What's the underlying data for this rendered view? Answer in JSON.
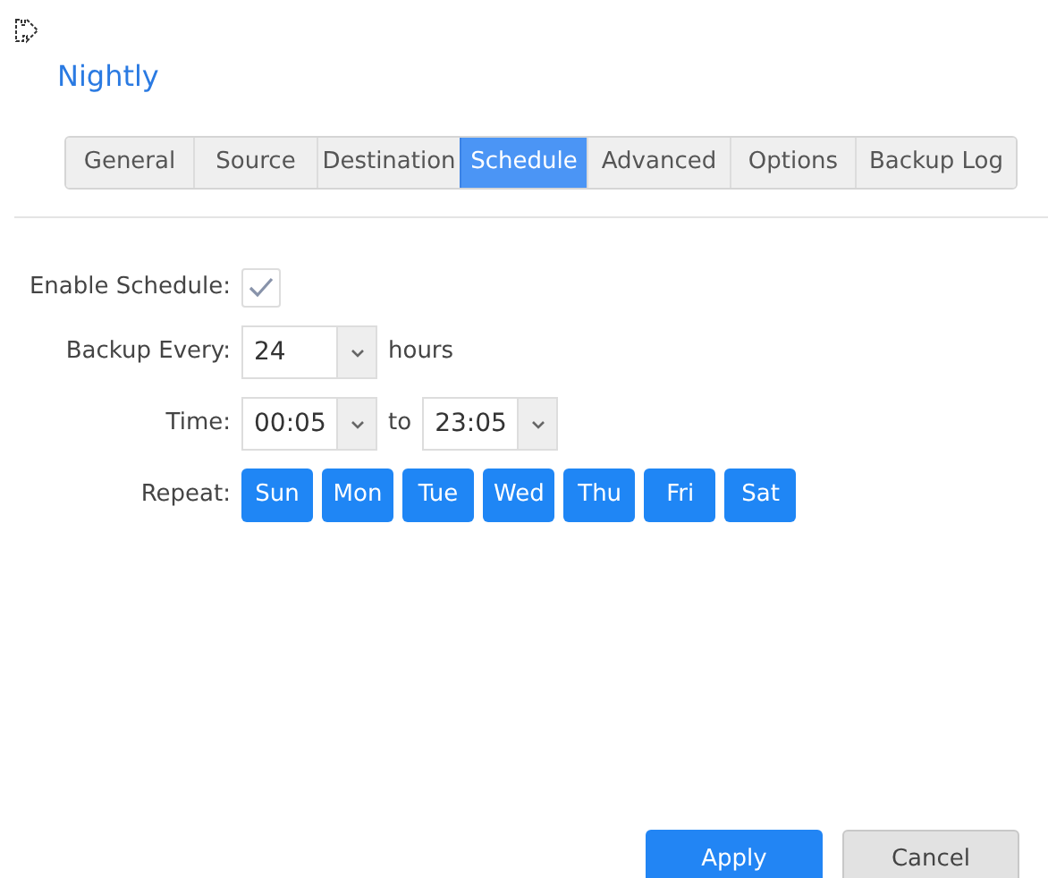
{
  "title": "Nightly",
  "tabs": [
    {
      "label": "General",
      "selected": false
    },
    {
      "label": "Source",
      "selected": false
    },
    {
      "label": "Destination",
      "selected": false
    },
    {
      "label": "Schedule",
      "selected": true
    },
    {
      "label": "Advanced",
      "selected": false
    },
    {
      "label": "Options",
      "selected": false
    },
    {
      "label": "Backup Log",
      "selected": false
    }
  ],
  "enable_schedule": {
    "label": "Enable Schedule:",
    "checked": true
  },
  "backup_every": {
    "label": "Backup Every:",
    "value": "24",
    "unit": "hours"
  },
  "time": {
    "label": "Time:",
    "from": "00:05",
    "separator": "to",
    "to": "23:05"
  },
  "repeat": {
    "label": "Repeat:",
    "days": [
      {
        "label": "Sun",
        "selected": true
      },
      {
        "label": "Mon",
        "selected": true
      },
      {
        "label": "Tue",
        "selected": true
      },
      {
        "label": "Wed",
        "selected": true
      },
      {
        "label": "Thu",
        "selected": true
      },
      {
        "label": "Fri",
        "selected": true
      },
      {
        "label": "Sat",
        "selected": true
      }
    ]
  },
  "buttons": [
    {
      "label": "Apply",
      "kind": "primary"
    },
    {
      "label": "Cancel",
      "kind": "secondary"
    }
  ]
}
